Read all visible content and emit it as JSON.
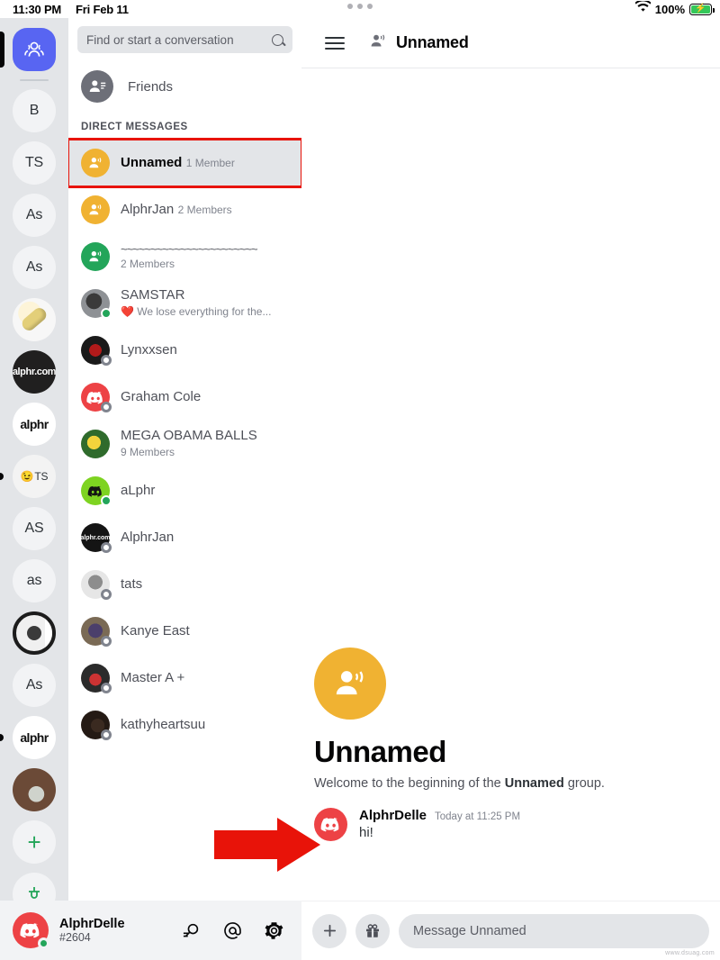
{
  "status_bar": {
    "time": "11:30 PM",
    "date": "Fri Feb 11",
    "battery_percent": "100%",
    "wifi_icon": "wifi-icon",
    "battery_icon": "battery-charging-icon",
    "multitask_handle": "three-dots-handle"
  },
  "server_rail": {
    "home_icon": "direct-messages-home-icon",
    "add_server_label": "+",
    "items": [
      {
        "label": "",
        "art": "home",
        "name": "home",
        "active": true,
        "pill": "active"
      },
      {
        "label": "B",
        "art": "text",
        "name": "server-b",
        "pill": "none"
      },
      {
        "label": "TS",
        "art": "text",
        "name": "server-ts",
        "pill": "none"
      },
      {
        "label": "As",
        "art": "text",
        "name": "server-as-1",
        "pill": "none"
      },
      {
        "label": "As",
        "art": "text",
        "name": "server-as-2",
        "pill": "none"
      },
      {
        "label": "",
        "art": "art-pill",
        "name": "server-pill-image",
        "pill": "none"
      },
      {
        "label": "alphr.com",
        "art": "art-alphrdark",
        "name": "server-alphr-com",
        "pill": "none"
      },
      {
        "label": "alphr",
        "art": "art-alphrlight",
        "name": "server-alphr",
        "pill": "none"
      },
      {
        "label": "TS",
        "art": "art-emoji",
        "name": "server-wink-ts",
        "pill": "dot"
      },
      {
        "label": "AS",
        "art": "text",
        "name": "server-as-caps",
        "pill": "none"
      },
      {
        "label": "as",
        "art": "text",
        "name": "server-as-lower",
        "pill": "none"
      },
      {
        "label": "",
        "art": "art-target",
        "name": "server-target-image",
        "pill": "none"
      },
      {
        "label": "As",
        "art": "text",
        "name": "server-as-3",
        "pill": "none"
      },
      {
        "label": "alphr",
        "art": "art-alphrlight",
        "name": "server-alphr-2",
        "pill": "dot"
      },
      {
        "label": "",
        "art": "art-dog",
        "name": "server-dog-image",
        "pill": "none"
      },
      {
        "label": "+",
        "art": "add",
        "name": "add-server",
        "pill": "none"
      }
    ]
  },
  "search": {
    "placeholder": "Find or start a conversation",
    "icon": "search-icon"
  },
  "friends": {
    "label": "Friends",
    "icon": "friends-icon"
  },
  "dm_section": {
    "header": "DIRECT MESSAGES",
    "items": [
      {
        "name": "Unnamed",
        "sub": "1 Member",
        "avatar": "av-gold",
        "type": "group",
        "presence": "none",
        "selected": true,
        "highlighted": true
      },
      {
        "name": "AlphrJan",
        "sub": "2 Members",
        "avatar": "av-gold",
        "type": "group",
        "presence": "none",
        "selected": false,
        "highlighted": false
      },
      {
        "name": "~~~~~~~~~~~~~~~~~~~~~~~",
        "sub": "2 Members",
        "avatar": "av-green",
        "type": "group",
        "presence": "none",
        "selected": false,
        "highlighted": false,
        "squiggle": true
      },
      {
        "name": "SAMSTAR",
        "sub": "❤️ We lose everything for the...",
        "avatar": "av-samstar",
        "type": "user",
        "presence": "online",
        "selected": false,
        "highlighted": false
      },
      {
        "name": "Lynxxsen",
        "sub": "",
        "avatar": "av-lynx",
        "type": "user",
        "presence": "offline",
        "selected": false,
        "highlighted": false
      },
      {
        "name": "Graham Cole",
        "sub": "",
        "avatar": "av-red",
        "type": "user",
        "presence": "offline",
        "selected": false,
        "highlighted": false
      },
      {
        "name": "MEGA OBAMA BALLS",
        "sub": "9 Members",
        "avatar": "av-sponge",
        "type": "group",
        "presence": "none",
        "selected": false,
        "highlighted": false
      },
      {
        "name": "aLphr",
        "sub": "",
        "avatar": "av-lime",
        "type": "user",
        "presence": "online",
        "selected": false,
        "highlighted": false
      },
      {
        "name": "AlphrJan",
        "sub": "",
        "avatar": "av-blk",
        "type": "user",
        "presence": "offline",
        "selected": false,
        "highlighted": false,
        "avatar_text": "alphr.com"
      },
      {
        "name": "tats",
        "sub": "",
        "avatar": "av-tats",
        "type": "user",
        "presence": "offline",
        "selected": false,
        "highlighted": false
      },
      {
        "name": "Kanye East",
        "sub": "",
        "avatar": "av-kanye",
        "type": "user",
        "presence": "offline",
        "selected": false,
        "highlighted": false
      },
      {
        "name": "Master A +",
        "sub": "",
        "avatar": "av-master",
        "type": "user",
        "presence": "offline",
        "selected": false,
        "highlighted": false
      },
      {
        "name": "kathyheartsuu",
        "sub": "",
        "avatar": "av-kathy",
        "type": "user",
        "presence": "offline",
        "selected": false,
        "highlighted": false
      }
    ]
  },
  "account_bar": {
    "username": "AlphrDelle",
    "discriminator": "#2604",
    "avatar_icon": "discord-logo-avatar",
    "presence": "online",
    "actions": [
      {
        "name": "search-dm-icon",
        "label": "search"
      },
      {
        "name": "mentions-icon",
        "label": "@"
      },
      {
        "name": "settings-gear-icon",
        "label": "settings"
      }
    ]
  },
  "chat_header": {
    "menu_icon": "hamburger-menu-icon",
    "group_icon": "group-members-icon",
    "title": "Unnamed"
  },
  "welcome": {
    "avatar_icon": "group-avatar-icon",
    "title": "Unnamed",
    "subtitle_prefix": "Welcome to the beginning of the ",
    "subtitle_bold": "Unnamed",
    "subtitle_suffix": " group."
  },
  "messages": [
    {
      "author": "AlphrDelle",
      "timestamp": "Today at 11:25 PM",
      "text": "hi!",
      "avatar_icon": "discord-logo-avatar"
    }
  ],
  "composer": {
    "add_label": "+",
    "add_icon": "plus-icon",
    "gift_icon": "gift-icon",
    "placeholder": "Message Unnamed"
  },
  "annotations": {
    "arrow_color": "#e81309",
    "highlight_color": "#e81309",
    "arrow_target": "message-avatar",
    "highlight_target": "dm-item-unnamed"
  },
  "watermark": "www.dsuag.com",
  "colors": {
    "brand_blurple": "#5865F2",
    "group_gold": "#f0b232",
    "online_green": "#23a55a",
    "discord_red": "#ed4245",
    "annotation_red": "#e81309",
    "rail_bg": "#e3e5e8"
  }
}
